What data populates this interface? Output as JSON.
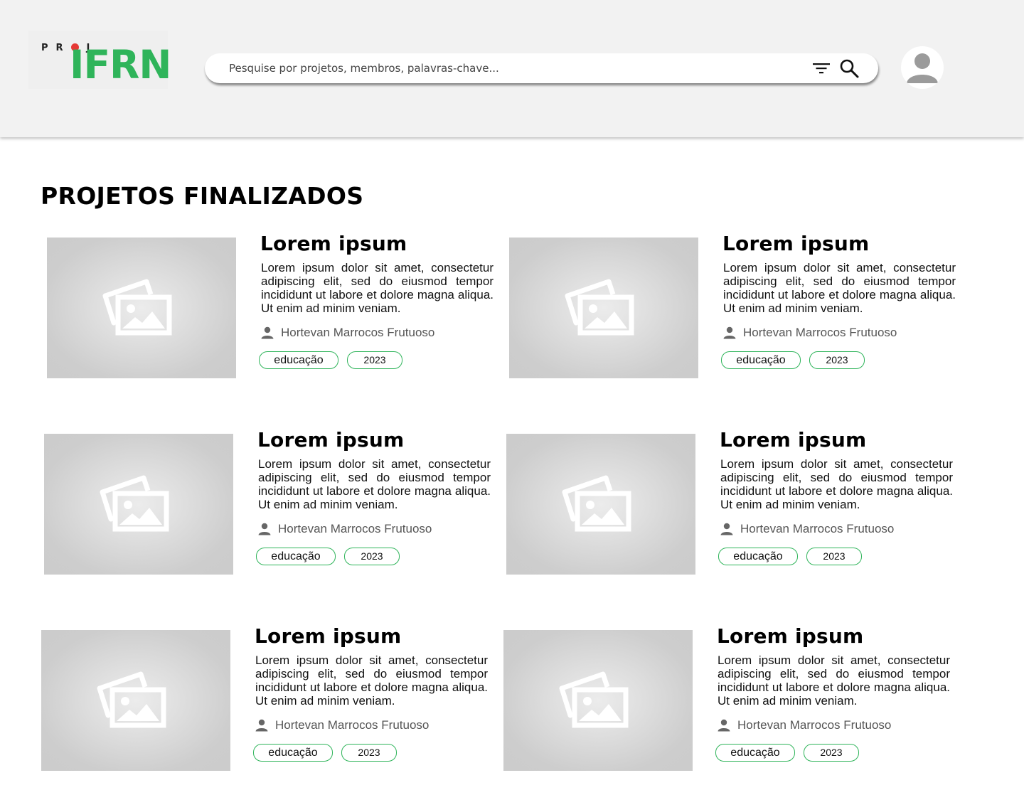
{
  "header": {
    "logo": {
      "small_text": "PROJ",
      "main_text": "IFRN"
    },
    "search": {
      "placeholder": "Pesquise por projetos, membros, palavras-chave..."
    }
  },
  "page": {
    "title": "PROJETOS FINALIZADOS"
  },
  "projects": [
    {
      "title": "Lorem ipsum",
      "description": "Lorem ipsum dolor sit amet, consectetur adipiscing elit, sed do eiusmod tempor incididunt ut labore et dolore magna aliqua. Ut enim ad minim veniam.",
      "author": "Hortevan Marrocos Frutuoso",
      "category": "educação",
      "year": "2023"
    },
    {
      "title": "Lorem ipsum",
      "description": "Lorem ipsum dolor sit amet, consectetur adipiscing elit, sed do eiusmod tempor incididunt ut labore et dolore magna aliqua. Ut enim ad minim veniam.",
      "author": "Hortevan Marrocos Frutuoso",
      "category": "educação",
      "year": "2023"
    },
    {
      "title": "Lorem ipsum",
      "description": "Lorem ipsum dolor sit amet, consectetur adipiscing elit, sed do eiusmod tempor incididunt ut labore et dolore magna aliqua. Ut enim ad minim veniam.",
      "author": "Hortevan Marrocos Frutuoso",
      "category": "educação",
      "year": "2023"
    },
    {
      "title": "Lorem ipsum",
      "description": "Lorem ipsum dolor sit amet, consectetur adipiscing elit, sed do eiusmod tempor incididunt ut labore et dolore magna aliqua. Ut enim ad minim veniam.",
      "author": "Hortevan Marrocos Frutuoso",
      "category": "educação",
      "year": "2023"
    },
    {
      "title": "Lorem ipsum",
      "description": "Lorem ipsum dolor sit amet, consectetur adipiscing elit, sed do eiusmod tempor incididunt ut labore et dolore magna aliqua. Ut enim ad minim veniam.",
      "author": "Hortevan Marrocos Frutuoso",
      "category": "educação",
      "year": "2023"
    },
    {
      "title": "Lorem ipsum",
      "description": "Lorem ipsum dolor sit amet, consectetur adipiscing elit, sed do eiusmod tempor incididunt ut labore et dolore magna aliqua. Ut enim ad minim veniam.",
      "author": "Hortevan Marrocos Frutuoso",
      "category": "educação",
      "year": "2023"
    }
  ],
  "icons": {
    "filter": "filter-icon",
    "search": "search-icon",
    "avatar": "user-avatar-icon",
    "author": "person-icon",
    "thumbnail": "image-placeholder-icon"
  },
  "colors": {
    "brand_green": "#2fb45a",
    "brand_red": "#e53935",
    "header_bg": "#f2f2f2",
    "thumb_bg": "#cccccc"
  }
}
